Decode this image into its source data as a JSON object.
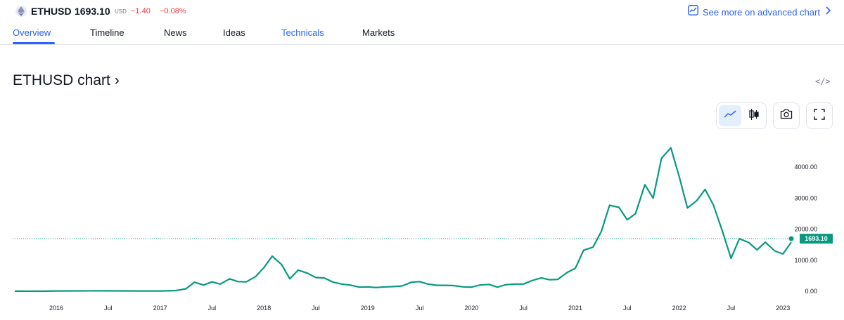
{
  "header": {
    "symbol": "ETHUSD",
    "price": "1693.10",
    "currency": "USD",
    "change": "−1.40",
    "change_percent": "−0.08%",
    "advanced_chart_label": "See more on advanced chart",
    "change_color": "#f23645",
    "accent_color": "#2962ff"
  },
  "tabs": [
    {
      "label": "Overview"
    },
    {
      "label": "Timeline"
    },
    {
      "label": "News"
    },
    {
      "label": "Ideas"
    },
    {
      "label": "Technicals"
    },
    {
      "label": "Markets"
    }
  ],
  "chart_header": {
    "title": "ETHUSD chart ›",
    "embed_icon": "</>"
  },
  "toolbar": {
    "icons": [
      "line-chart-icon",
      "candlestick-icon",
      "camera-icon",
      "fullscreen-icon"
    ]
  },
  "chart_data": {
    "type": "line",
    "line_color": "#089981",
    "last_price_label": "1693.10",
    "ylim": [
      0,
      4750
    ],
    "y_ticks": [
      {
        "label": "4000.00",
        "value": 4000
      },
      {
        "label": "3000.00",
        "value": 3000
      },
      {
        "label": "2000.00",
        "value": 2000
      },
      {
        "label": "1000.00",
        "value": 1000
      },
      {
        "label": "0.00",
        "value": 0
      }
    ],
    "x_ticks": [
      {
        "label": "2016",
        "t": 2016.0
      },
      {
        "label": "Jul",
        "t": 2016.5
      },
      {
        "label": "2017",
        "t": 2017.0
      },
      {
        "label": "Jul",
        "t": 2017.5
      },
      {
        "label": "2018",
        "t": 2018.0
      },
      {
        "label": "Jul",
        "t": 2018.5
      },
      {
        "label": "2019",
        "t": 2019.0
      },
      {
        "label": "Jul",
        "t": 2019.5
      },
      {
        "label": "2020",
        "t": 2020.0
      },
      {
        "label": "Jul",
        "t": 2020.5
      },
      {
        "label": "2021",
        "t": 2021.0
      },
      {
        "label": "Jul",
        "t": 2021.5
      },
      {
        "label": "2022",
        "t": 2022.0
      },
      {
        "label": "Jul",
        "t": 2022.5
      },
      {
        "label": "2023",
        "t": 2023.0
      }
    ],
    "x_range": [
      2015.58,
      2023.08
    ],
    "x": [
      2015.6,
      2015.85,
      2016.0,
      2016.2,
      2016.4,
      2016.6,
      2016.8,
      2017.0,
      2017.15,
      2017.25,
      2017.33,
      2017.42,
      2017.5,
      2017.58,
      2017.67,
      2017.75,
      2017.83,
      2017.92,
      2018.0,
      2018.08,
      2018.17,
      2018.25,
      2018.33,
      2018.42,
      2018.5,
      2018.58,
      2018.67,
      2018.75,
      2018.83,
      2018.92,
      2019.0,
      2019.08,
      2019.17,
      2019.25,
      2019.33,
      2019.42,
      2019.5,
      2019.58,
      2019.67,
      2019.75,
      2019.83,
      2019.92,
      2020.0,
      2020.08,
      2020.17,
      2020.25,
      2020.33,
      2020.42,
      2020.5,
      2020.58,
      2020.67,
      2020.75,
      2020.83,
      2020.92,
      2021.0,
      2021.08,
      2021.17,
      2021.25,
      2021.33,
      2021.42,
      2021.5,
      2021.58,
      2021.67,
      2021.75,
      2021.83,
      2021.92,
      2022.0,
      2022.08,
      2022.17,
      2022.25,
      2022.33,
      2022.42,
      2022.5,
      2022.58,
      2022.67,
      2022.75,
      2022.83,
      2022.92,
      2023.0,
      2023.08
    ],
    "values": [
      2,
      1,
      10,
      12,
      14,
      12,
      8,
      10,
      20,
      80,
      290,
      200,
      300,
      230,
      400,
      310,
      300,
      470,
      760,
      1130,
      860,
      400,
      680,
      580,
      440,
      430,
      290,
      230,
      200,
      130,
      140,
      120,
      140,
      150,
      170,
      290,
      310,
      230,
      190,
      190,
      180,
      140,
      130,
      200,
      220,
      130,
      210,
      230,
      230,
      340,
      430,
      370,
      380,
      600,
      740,
      1320,
      1420,
      1920,
      2770,
      2700,
      2300,
      2500,
      3430,
      3000,
      4280,
      4620,
      3700,
      2680,
      2920,
      3280,
      2780,
      1900,
      1060,
      1690,
      1570,
      1330,
      1580,
      1300,
      1200,
      1580,
      1693
    ]
  }
}
